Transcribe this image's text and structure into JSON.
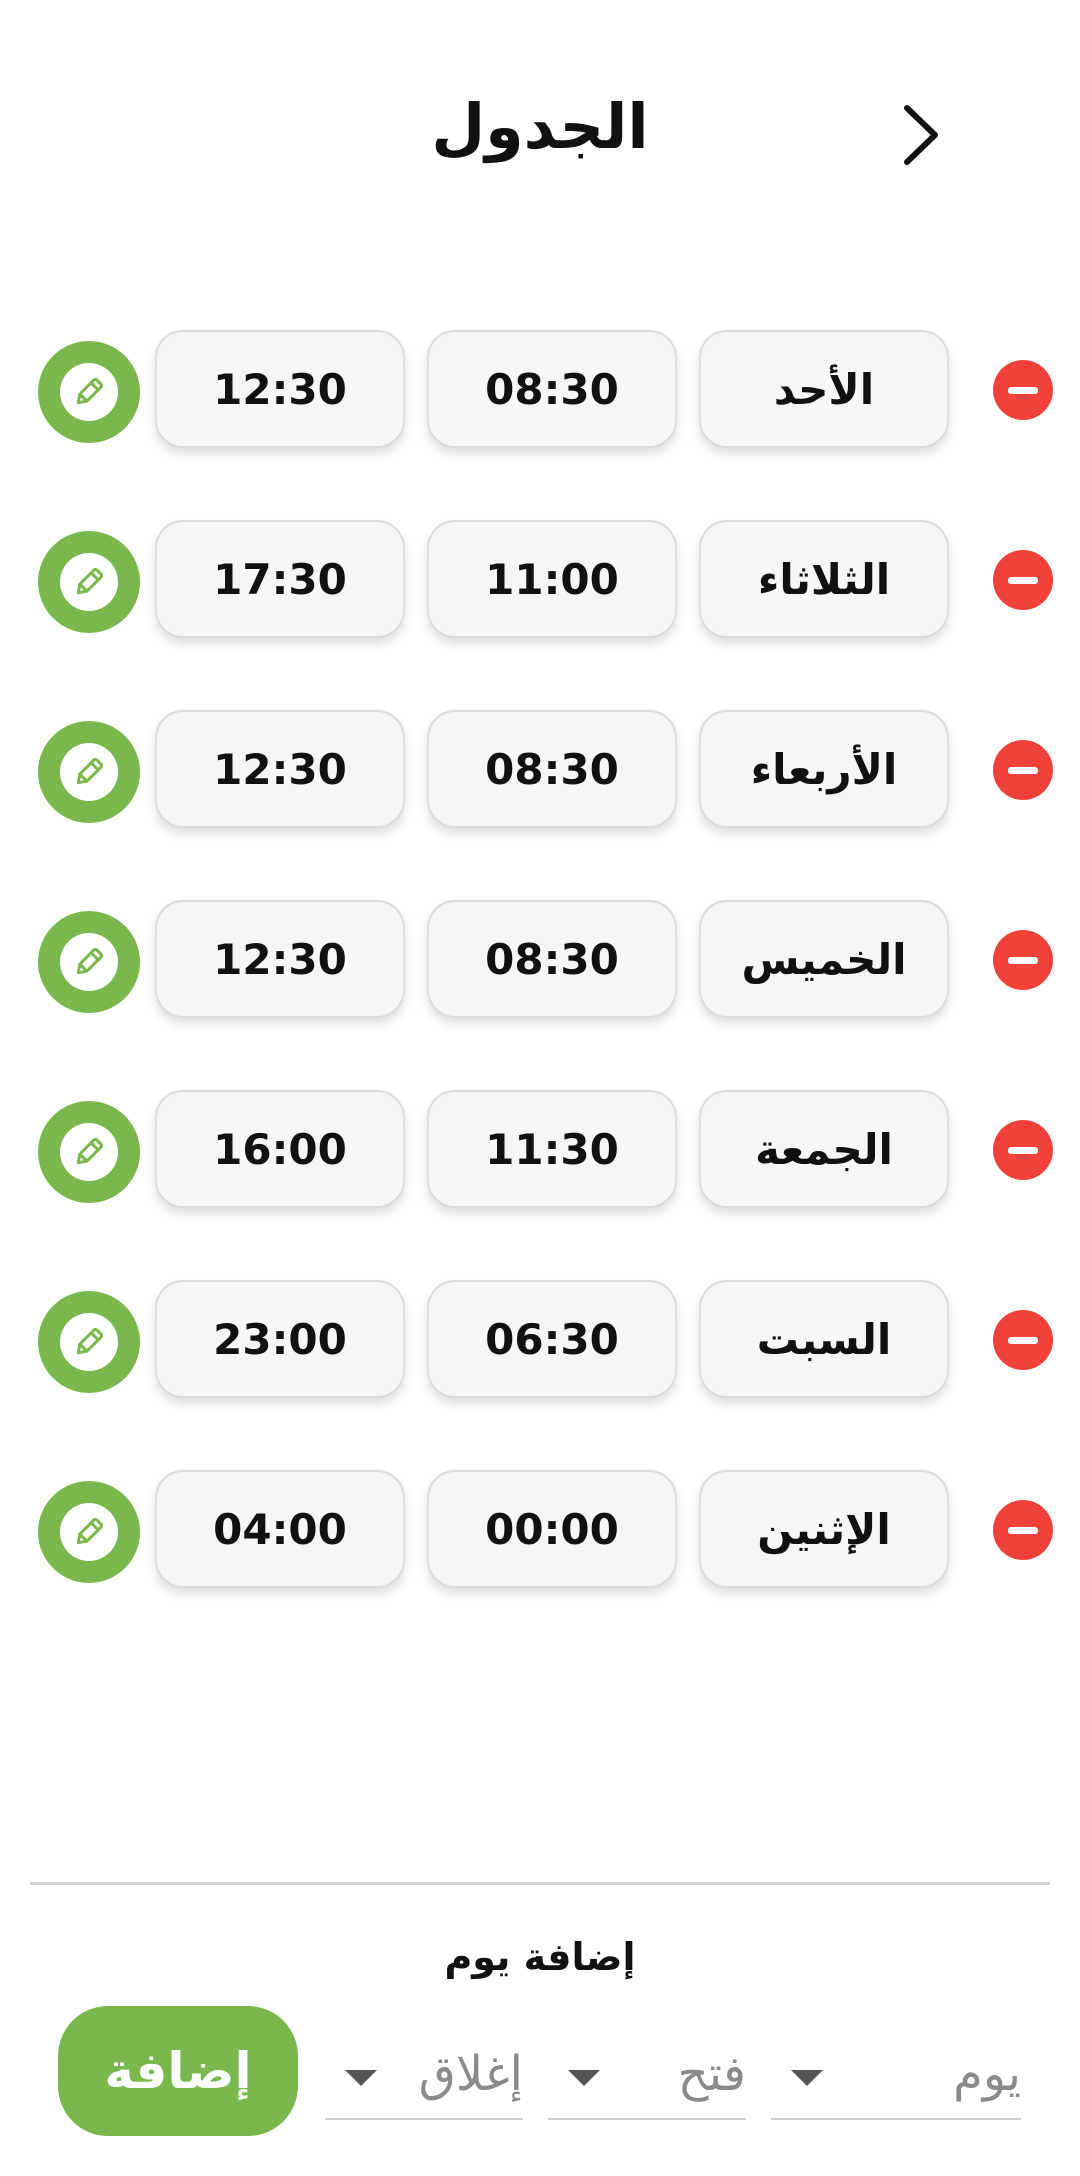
{
  "header": {
    "title": "الجدول",
    "back_icon": "chevron-right-icon"
  },
  "schedule": [
    {
      "day": "الأحد",
      "open": "08:30",
      "close": "12:30"
    },
    {
      "day": "الثلاثاء",
      "open": "11:00",
      "close": "17:30"
    },
    {
      "day": "الأربعاء",
      "open": "08:30",
      "close": "12:30"
    },
    {
      "day": "الخميس",
      "open": "08:30",
      "close": "12:30"
    },
    {
      "day": "الجمعة",
      "open": "11:30",
      "close": "16:00"
    },
    {
      "day": "السبت",
      "open": "06:30",
      "close": "23:00"
    },
    {
      "day": "الإثنين",
      "open": "00:00",
      "close": "04:00"
    }
  ],
  "add_section": {
    "title": "إضافة يوم",
    "day_placeholder": "يوم",
    "open_placeholder": "فتح",
    "close_placeholder": "إغلاق",
    "add_button": "إضافة"
  },
  "colors": {
    "accent_green": "#7ab84d",
    "remove_red": "#f0423a"
  }
}
